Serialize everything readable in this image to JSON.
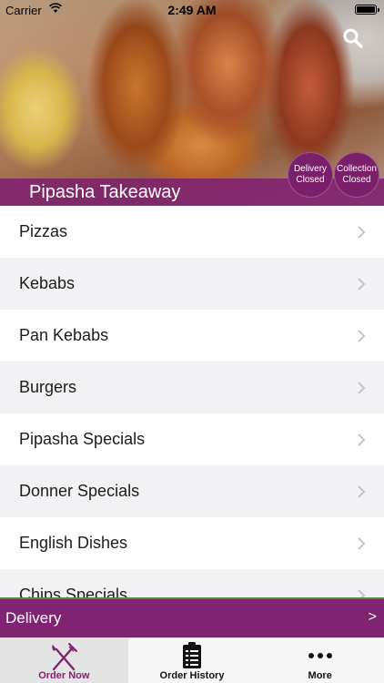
{
  "status_bar": {
    "carrier": "Carrier",
    "time": "2:49 AM"
  },
  "header": {
    "title": "Pipasha Takeaway",
    "delivery_status": {
      "line1": "Delivery",
      "line2": "Closed"
    },
    "collection_status": {
      "line1": "Collection",
      "line2": "Closed"
    },
    "search_icon": "search-icon"
  },
  "menu": {
    "items": [
      {
        "label": "Pizzas"
      },
      {
        "label": "Kebabs"
      },
      {
        "label": "Pan Kebabs"
      },
      {
        "label": "Burgers"
      },
      {
        "label": "Pipasha Specials"
      },
      {
        "label": "Donner Specials"
      },
      {
        "label": "English Dishes"
      },
      {
        "label": "Chips Specials"
      }
    ]
  },
  "delivery_bar": {
    "label": "Delivery",
    "arrow": ">"
  },
  "tabs": [
    {
      "label": "Order Now",
      "icon": "fork-knife-icon",
      "active": true
    },
    {
      "label": "Order History",
      "icon": "clipboard-list-icon",
      "active": false
    },
    {
      "label": "More",
      "icon": "more-dots-icon",
      "active": false
    }
  ],
  "colors": {
    "brand": "#7e2470",
    "active_tab_text": "#7e2470",
    "delivery_bar_top_border": "#4f8a3a"
  }
}
